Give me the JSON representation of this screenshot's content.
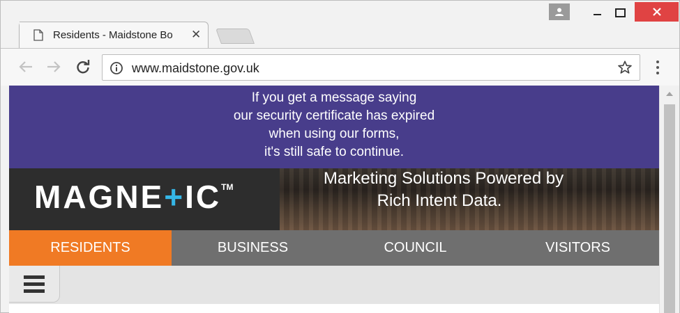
{
  "browser": {
    "tab_title": "Residents - Maidstone Bo",
    "url": "www.maidstone.gov.uk",
    "icons": {
      "page": "page-icon",
      "close_tab": "close-icon",
      "back": "back-arrow-icon",
      "forward": "forward-arrow-icon",
      "reload": "reload-icon",
      "info": "info-icon",
      "bookmark": "star-icon",
      "menu": "kebab-menu-icon",
      "profile": "person-icon"
    },
    "tab_close_glyph": "✕",
    "window_close_glyph": "✕"
  },
  "notice": {
    "lines": [
      "If you get a message saying",
      "our security certificate has expired",
      "when using our forms,",
      "it's still safe to continue."
    ],
    "background": "#483d8b"
  },
  "ad": {
    "logo_pre": "MAGNE",
    "logo_plus": "+",
    "logo_post": "IC",
    "logo_tm": "TM",
    "tagline_line1": "Marketing Solutions Powered by",
    "tagline_line2": "Rich Intent Data."
  },
  "nav": {
    "items": [
      {
        "label": "RESIDENTS",
        "active": true
      },
      {
        "label": "BUSINESS",
        "active": false
      },
      {
        "label": "COUNCIL",
        "active": false
      },
      {
        "label": "VISITORS",
        "active": false
      }
    ],
    "active_color": "#f07a24",
    "bar_color": "#6f6f6f"
  }
}
